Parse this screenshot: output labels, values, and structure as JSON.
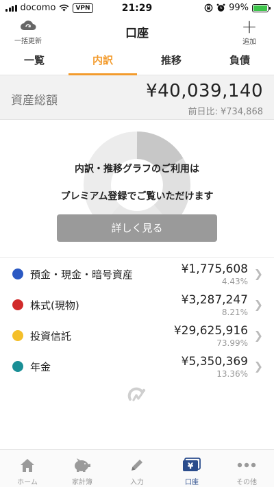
{
  "status_bar": {
    "carrier": "docomo",
    "vpn": "VPN",
    "time": "21:29",
    "battery": "99%"
  },
  "header": {
    "title": "口座",
    "left_button_label": "一括更新",
    "right_button_label": "追加"
  },
  "tabs": [
    {
      "label": "一覧",
      "active": false
    },
    {
      "label": "内訳",
      "active": true
    },
    {
      "label": "推移",
      "active": false
    },
    {
      "label": "負債",
      "active": false
    }
  ],
  "total": {
    "label": "資産総額",
    "amount": "¥40,039,140",
    "diff": "前日比: ¥734,868"
  },
  "premium": {
    "message_line1": "内訳・推移グラフのご利用は",
    "message_line2": "プレミアム登録でご覧いただけます",
    "button_label": "詳しく見る"
  },
  "breakdown": [
    {
      "name": "預金・現金・暗号資産",
      "value": "¥1,775,608",
      "percent": "4.43%",
      "color": "#2b59c3"
    },
    {
      "name": "株式(現物)",
      "value": "¥3,287,247",
      "percent": "8.21%",
      "color": "#d12a2a"
    },
    {
      "name": "投資信託",
      "value": "¥29,625,916",
      "percent": "73.99%",
      "color": "#f4bf2a"
    },
    {
      "name": "年金",
      "value": "¥5,350,369",
      "percent": "13.36%",
      "color": "#1a8f96"
    }
  ],
  "bottom_tabs": [
    {
      "label": "ホーム",
      "icon": "home-icon",
      "active": false
    },
    {
      "label": "家計簿",
      "icon": "piggy-bank-icon",
      "active": false
    },
    {
      "label": "入力",
      "icon": "pencil-icon",
      "active": false
    },
    {
      "label": "口座",
      "icon": "yen-card-icon",
      "active": true
    },
    {
      "label": "その他",
      "icon": "more-dots-icon",
      "active": false
    }
  ],
  "colors": {
    "accent": "#f39b2c",
    "active_tab": "#2a4c8c"
  }
}
